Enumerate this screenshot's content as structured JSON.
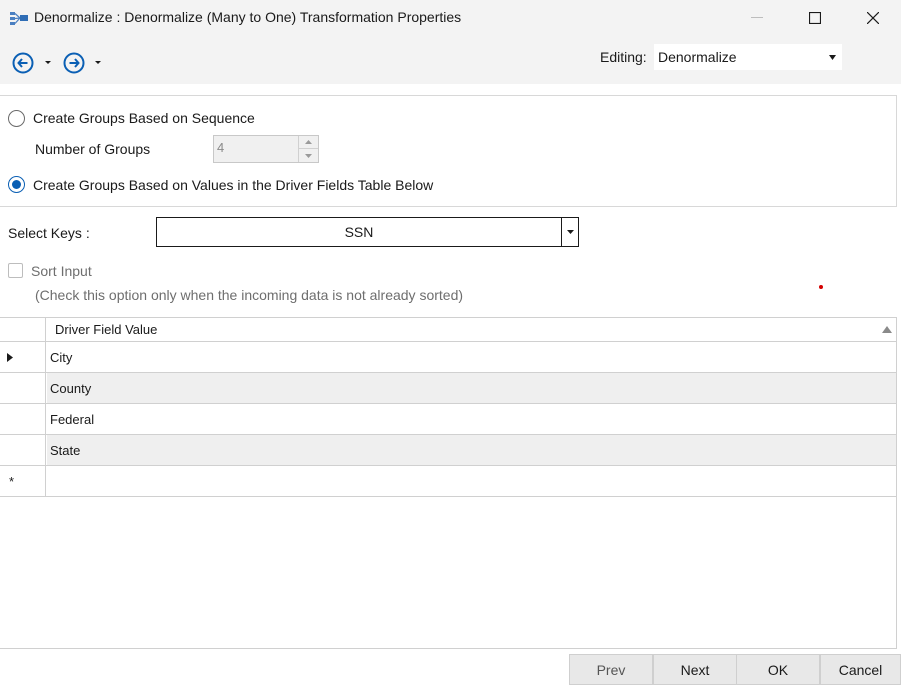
{
  "window": {
    "title": "Denormalize : Denormalize (Many to One) Transformation Properties",
    "controls": [
      "minimize-icon",
      "maximize-icon",
      "close-icon"
    ]
  },
  "toolbar": {
    "back_icon": "arrow-left-circle-icon",
    "forward_icon": "arrow-right-circle-icon",
    "editing_label": "Editing:",
    "editing_value": "Denormalize"
  },
  "grouping": {
    "option_sequence": "Create Groups Based on Sequence",
    "option_values": "Create Groups Based on Values in the Driver Fields Table Below",
    "selected": "values",
    "number_of_groups_label": "Number of Groups",
    "number_of_groups_value": "4"
  },
  "keys": {
    "label": "Select Keys :",
    "value": "SSN"
  },
  "sort": {
    "label": "Sort Input",
    "checked": false,
    "note": "(Check this option only when the incoming data is not already sorted)"
  },
  "grid": {
    "column_header": "Driver Field Value",
    "rows": [
      "City",
      "County",
      "Federal",
      "State"
    ],
    "new_row_marker": "*"
  },
  "footer": {
    "prev": "Prev",
    "next": "Next",
    "ok": "OK",
    "cancel": "Cancel"
  },
  "colors": {
    "accent": "#0a5fb4",
    "titlebar": "#f3f3f3",
    "alt_row": "#efefef"
  }
}
